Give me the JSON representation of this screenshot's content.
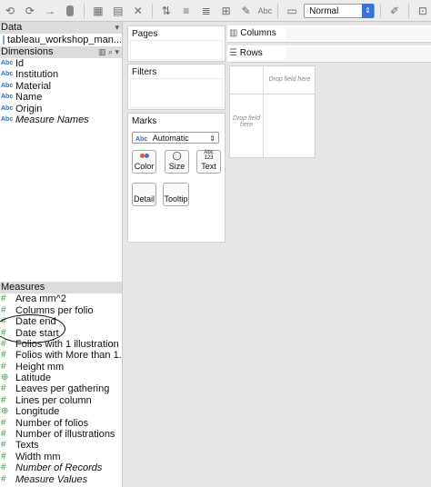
{
  "toolbar": {
    "abc_label": "Abc",
    "view_mode": "Normal"
  },
  "data_pane": {
    "header": "Data",
    "datasource": "tableau_workshop_man...",
    "dimensions_header": "Dimensions",
    "dimensions": [
      {
        "type": "Abc",
        "label": "Id",
        "italic": false
      },
      {
        "type": "Abc",
        "label": "Institution",
        "italic": false
      },
      {
        "type": "Abc",
        "label": "Material",
        "italic": false
      },
      {
        "type": "Abc",
        "label": "Name",
        "italic": false
      },
      {
        "type": "Abc",
        "label": "Origin",
        "italic": false
      },
      {
        "type": "Abc",
        "label": "Measure Names",
        "italic": true
      }
    ],
    "measures_header": "Measures",
    "measures": [
      {
        "type": "#",
        "label": "Area mm^2",
        "italic": false
      },
      {
        "type": "#",
        "label": "Columns per folio",
        "italic": false
      },
      {
        "type": "#",
        "label": "Date end",
        "italic": false
      },
      {
        "type": "#",
        "label": "Date start",
        "italic": false
      },
      {
        "type": "#",
        "label": "Folios with 1 illustration",
        "italic": false
      },
      {
        "type": "#",
        "label": "Folios with More than 1...",
        "italic": false
      },
      {
        "type": "#",
        "label": "Height mm",
        "italic": false
      },
      {
        "type": "geo",
        "label": "Latitude",
        "italic": false
      },
      {
        "type": "#",
        "label": "Leaves per gathering",
        "italic": false
      },
      {
        "type": "#",
        "label": "Lines per column",
        "italic": false
      },
      {
        "type": "geo",
        "label": "Longitude",
        "italic": false
      },
      {
        "type": "#",
        "label": "Number of folios",
        "italic": false
      },
      {
        "type": "#",
        "label": "Number of illustrations",
        "italic": false
      },
      {
        "type": "#",
        "label": "Texts",
        "italic": false
      },
      {
        "type": "#",
        "label": "Width mm",
        "italic": false
      },
      {
        "type": "#",
        "label": "Number of Records",
        "italic": true
      },
      {
        "type": "#",
        "label": "Measure Values",
        "italic": true
      }
    ]
  },
  "pages": {
    "title": "Pages"
  },
  "filters": {
    "title": "Filters"
  },
  "marks": {
    "title": "Marks",
    "type_icon": "Abc",
    "type": "Automatic",
    "buttons": {
      "color": "Color",
      "size": "Size",
      "text": "Text",
      "detail": "Detail",
      "tooltip": "Tooltip"
    },
    "text_icon": "Abc 123"
  },
  "shelves": {
    "columns": "Columns",
    "rows": "Rows"
  },
  "viz": {
    "drop_top": "Drop field here",
    "drop_left": "Drop field here"
  }
}
